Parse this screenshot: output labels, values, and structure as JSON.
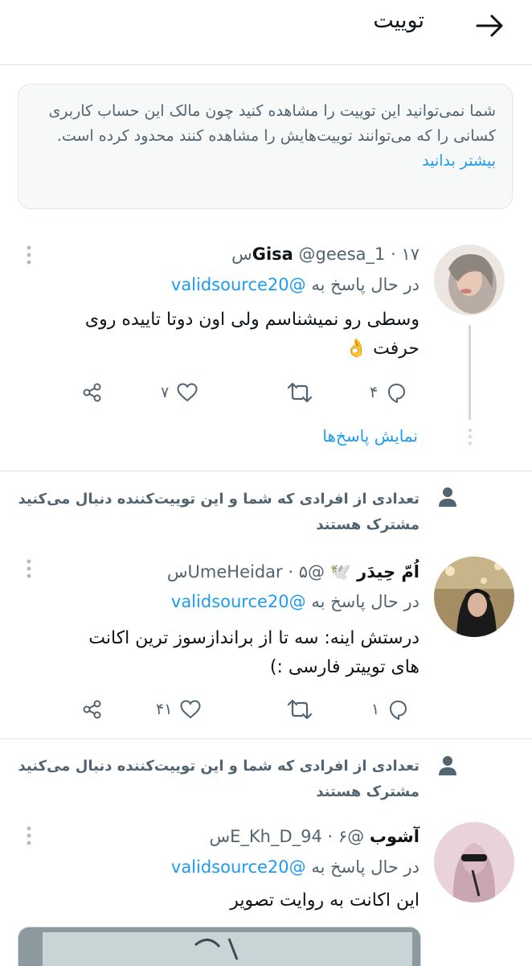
{
  "header": {
    "title": "توییت",
    "back_icon": "arrow-right-icon"
  },
  "notice": {
    "text": "شما نمی‌توانید این توییت را مشاهده کنید چون مالک این حساب کاربری کسانی را که می‌توانند توییت‌هایش را مشاهده کنند محدود کرده است.",
    "link": "بیشتر بدانید"
  },
  "social_context": "تعدادی از افرادی که شما و این توییت‌کننده دنبال می‌کنید مشترک هستند",
  "show_replies": "نمایش پاسخ‌ها",
  "reply_prefix": "در حال پاسخ به",
  "colors": {
    "accent": "#1d9bf0",
    "muted": "#536471",
    "border": "#dde3e8"
  },
  "tweets": [
    {
      "name": "Gisa",
      "handle": "@geesa_1",
      "sep": "·",
      "time": "۱۷س",
      "mention": "@validsource20",
      "text": "وسطی رو نمیشناسم ولی اون دوتا تاییده روی حرفت 👌",
      "replies": "۴",
      "retweets": "",
      "likes": "۷"
    },
    {
      "name": "اُمّ حِیدَر 🕊️",
      "handle": "@UmeHeidar",
      "sep": "·",
      "time": "۵س",
      "mention": "@validsource20",
      "text": "درستش اینه: سه تا از براندازسوز ترین اکانت های توییتر فارسی :)",
      "replies": "۱",
      "retweets": "",
      "likes": "۴۱"
    },
    {
      "name": "آشوب",
      "handle": "@E_Kh_D_94",
      "sep": "·",
      "time": "۶س",
      "mention": "@validsource20",
      "text": "این اکانت به روایت تصویر"
    }
  ]
}
